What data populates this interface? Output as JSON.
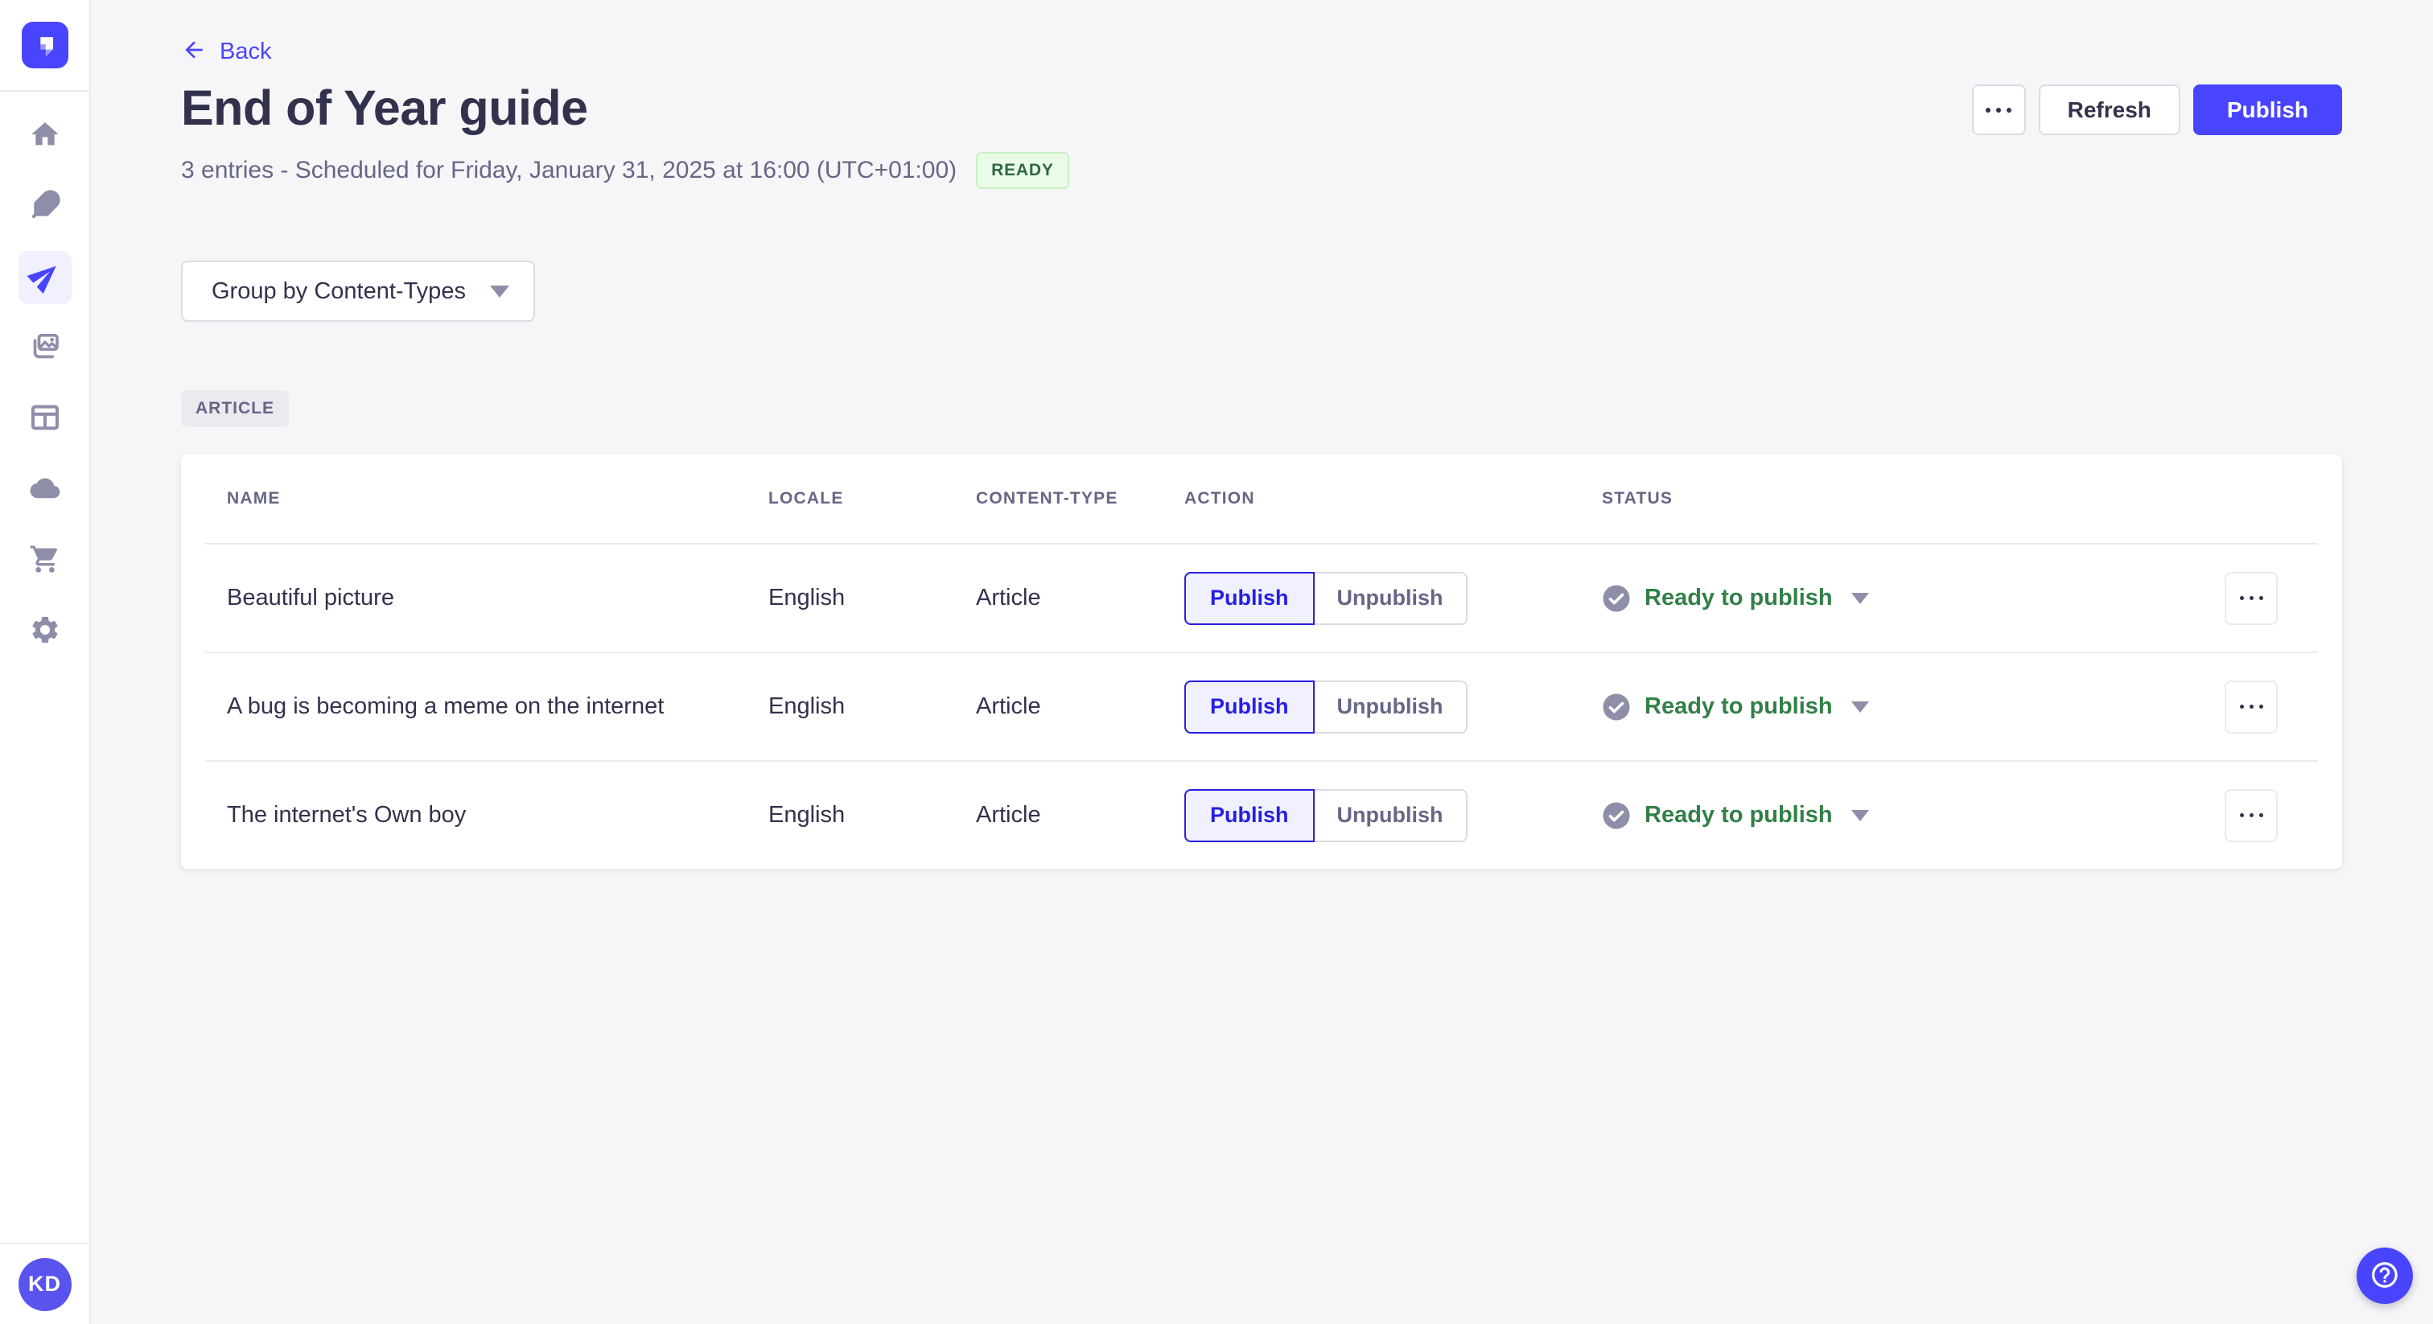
{
  "sidebar": {
    "items": [
      {
        "icon": "home"
      },
      {
        "icon": "feather-pen"
      },
      {
        "icon": "paper-plane",
        "active": true
      },
      {
        "icon": "media-images"
      },
      {
        "icon": "layout-panels"
      },
      {
        "icon": "cloud"
      },
      {
        "icon": "shopping-cart"
      },
      {
        "icon": "settings-gear"
      }
    ],
    "avatar_initials": "KD"
  },
  "header": {
    "back_label": "Back",
    "title": "End of Year guide",
    "subtitle": "3 entries - Scheduled for Friday, January 31, 2025 at 16:00 (UTC+01:00)",
    "status_badge": "READY",
    "actions": {
      "refresh": "Refresh",
      "publish": "Publish"
    }
  },
  "toolbar": {
    "group_by": "Group by Content-Types"
  },
  "group": {
    "badge": "ARTICLE"
  },
  "table": {
    "columns": [
      "NAME",
      "LOCALE",
      "CONTENT-TYPE",
      "ACTION",
      "STATUS"
    ],
    "action_labels": {
      "publish": "Publish",
      "unpublish": "Unpublish"
    },
    "rows": [
      {
        "name": "Beautiful picture",
        "locale": "English",
        "content_type": "Article",
        "status": "Ready to publish"
      },
      {
        "name": "A bug is becoming a meme on the internet",
        "locale": "English",
        "content_type": "Article",
        "status": "Ready to publish"
      },
      {
        "name": "The internet's Own boy",
        "locale": "English",
        "content_type": "Article",
        "status": "Ready to publish"
      }
    ]
  },
  "colors": {
    "accent": "#4945ff",
    "accent_dark": "#271fe0",
    "accent_light": "#f0f0ff",
    "success_text": "#328048",
    "ready_badge_bg": "#eafbe7",
    "ready_badge_text": "#2f6846",
    "neutral_text": "#32324d",
    "muted_text": "#666687",
    "icon_gray": "#8e8ea9"
  }
}
